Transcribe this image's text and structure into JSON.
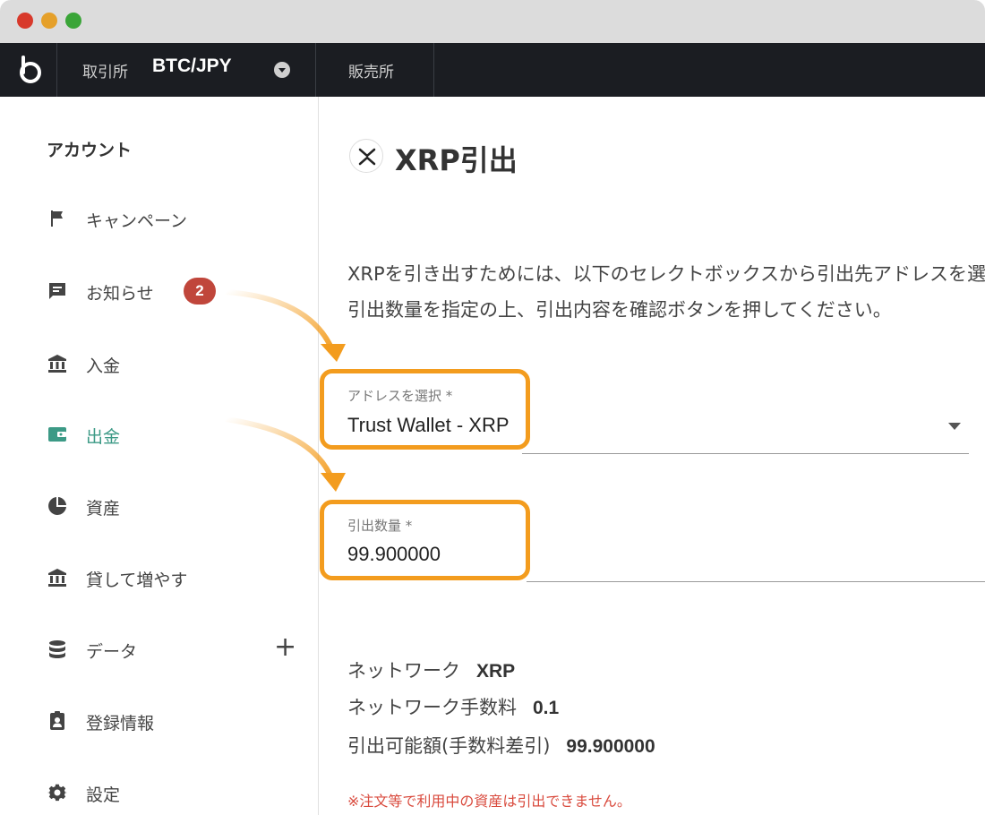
{
  "nav": {
    "exchange_label": "取引所",
    "pair": "BTC/JPY",
    "sales_label": "販売所"
  },
  "sidebar": {
    "title": "アカウント",
    "items": [
      {
        "label": "キャンペーン",
        "icon": "flag-icon"
      },
      {
        "label": "お知らせ",
        "icon": "message-icon",
        "badge": "2"
      },
      {
        "label": "入金",
        "icon": "bank-icon"
      },
      {
        "label": "出金",
        "icon": "wallet-icon",
        "active": true
      },
      {
        "label": "資産",
        "icon": "pie-chart-icon"
      },
      {
        "label": "貸して増やす",
        "icon": "bank-icon"
      },
      {
        "label": "データ",
        "icon": "database-icon",
        "expand": "+"
      },
      {
        "label": "登録情報",
        "icon": "badge-icon"
      },
      {
        "label": "設定",
        "icon": "gear-icon"
      }
    ]
  },
  "main": {
    "title": "XRP引出",
    "description_line1": "XRPを引き出すためには、以下のセレクトボックスから引出先アドレスを選択し",
    "description_line2": "引出数量を指定の上、引出内容を確認ボタンを押してください。",
    "address_field": {
      "label": "アドレスを選択 *",
      "value": "Trust Wallet - XRP"
    },
    "amount_field": {
      "label": "引出数量 *",
      "value": "99.900000"
    },
    "network_label": "ネットワーク",
    "network_value": "XRP",
    "fee_label": "ネットワーク手数料",
    "fee_value": "0.1",
    "available_label": "引出可能額(手数料差引)",
    "available_value": "99.900000",
    "warning": "※注文等で利用中の資産は引出できません。"
  },
  "colors": {
    "accent_teal": "#3c9a86",
    "highlight_orange": "#f39c1e",
    "badge_red": "#c0463b",
    "warning_red": "#d94a3d",
    "nav_dark": "#1b1d22"
  }
}
